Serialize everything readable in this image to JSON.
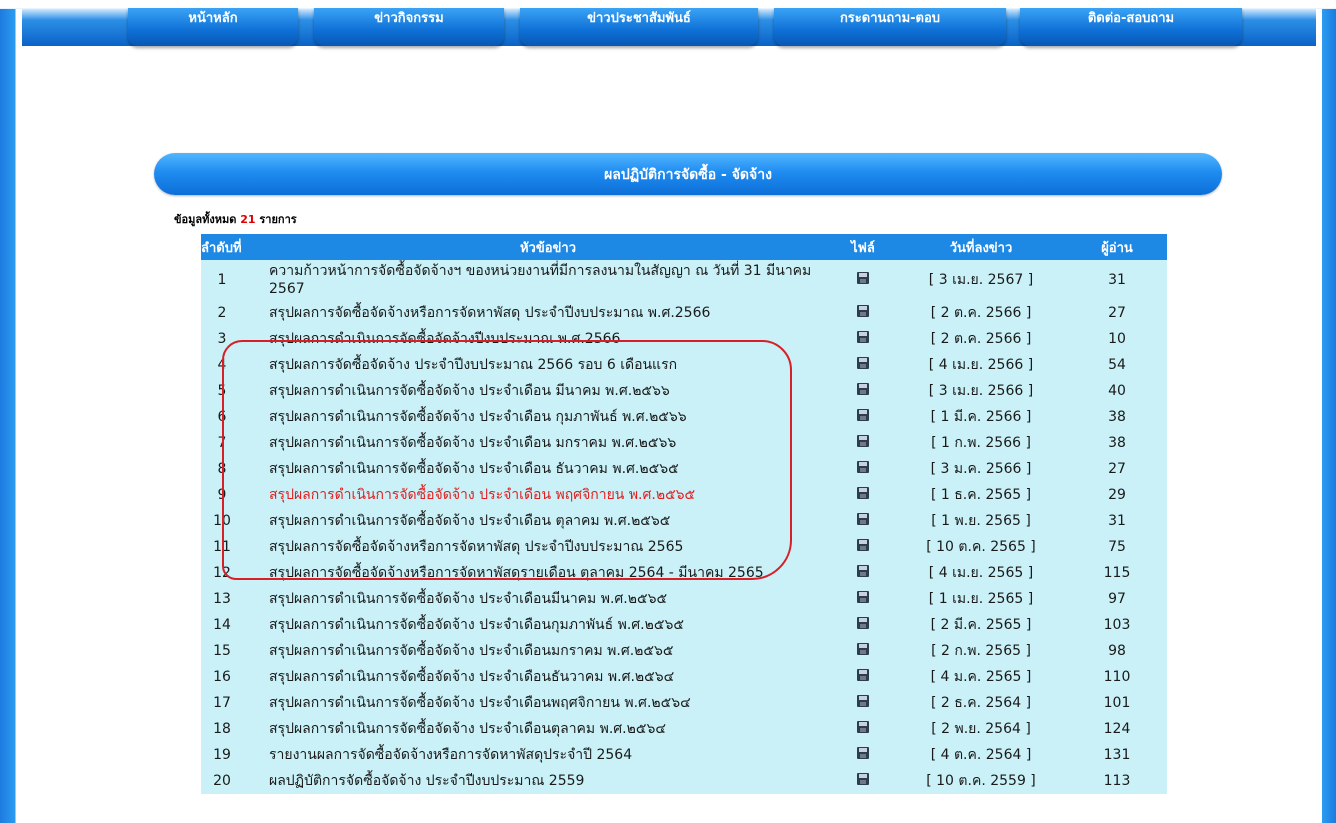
{
  "nav": {
    "items": [
      {
        "label": "หน้าหลัก"
      },
      {
        "label": "ข่าวกิจกรรม"
      },
      {
        "label": "ข่าวประชาสัมพันธ์"
      },
      {
        "label": "กระดานถาม-ตอบ"
      },
      {
        "label": "ติดต่อ-สอบถาม"
      }
    ]
  },
  "page": {
    "title": "ผลปฏิบัติการจัดซื้อ - จัดจ้าง",
    "count_prefix": "ข้อมูลทั้งหมด",
    "count": "21",
    "count_suffix": "รายการ"
  },
  "table": {
    "headers": {
      "index": "ลำดับที่",
      "title": "หัวข้อข่าว",
      "file": "ไฟล์",
      "date": "วันที่ลงข่าว",
      "readers": "ผู้อ่าน"
    },
    "rows": [
      {
        "no": "1",
        "title": "ความก้าวหน้าการจัดซื้อจัดจ้างฯ ของหน่วยงานที่มีการลงนามในสัญญา ณ วันที่ 31 มีนาคม 2567",
        "date": "[ 3 เม.ย. 2567 ]",
        "readers": "31"
      },
      {
        "no": "2",
        "title": "สรุปผลการจัดซื้อจัดจ้างหรือการจัดหาพัสดุ ประจำปีงบประมาณ พ.ศ.2566",
        "date": "[ 2 ต.ค. 2566 ]",
        "readers": "27"
      },
      {
        "no": "3",
        "title": "สรุปผลการดำเนินการจัดซื้อจัดจ้างปีงบประมาณ พ.ศ.2566",
        "date": "[ 2 ต.ค. 2566 ]",
        "readers": "10"
      },
      {
        "no": "4",
        "title": "สรุปผลการจัดซื้อจัดจ้าง ประจำปีงบประมาณ 2566 รอบ 6 เดือนแรก",
        "date": "[ 4 เม.ย. 2566 ]",
        "readers": "54"
      },
      {
        "no": "5",
        "title": "สรุปผลการดำเนินการจัดซื้อจัดจ้าง ประจำเดือน มีนาคม พ.ศ.๒๕๖๖",
        "date": "[ 3 เม.ย. 2566 ]",
        "readers": "40"
      },
      {
        "no": "6",
        "title": "สรุปผลการดำเนินการจัดซื้อจัดจ้าง ประจำเดือน กุมภาพันธ์ พ.ศ.๒๕๖๖",
        "date": "[ 1 มี.ค. 2566 ]",
        "readers": "38"
      },
      {
        "no": "7",
        "title": "สรุปผลการดำเนินการจัดซื้อจัดจ้าง ประจำเดือน มกราคม พ.ศ.๒๕๖๖",
        "date": "[ 1 ก.พ. 2566 ]",
        "readers": "38"
      },
      {
        "no": "8",
        "title": "สรุปผลการดำเนินการจัดซื้อจัดจ้าง ประจำเดือน ธันวาคม พ.ศ.๒๕๖๕",
        "date": "[ 3 ม.ค. 2566 ]",
        "readers": "27"
      },
      {
        "no": "9",
        "title": "สรุปผลการดำเนินการจัดซื้อจัดจ้าง ประจำเดือน พฤศจิกายน พ.ศ.๒๕๖๕",
        "date": "[ 1 ธ.ค. 2565 ]",
        "readers": "29",
        "highlight": true
      },
      {
        "no": "10",
        "title": "สรุปผลการดำเนินการจัดซื้อจัดจ้าง ประจำเดือน ตุลาคม พ.ศ.๒๕๖๕",
        "date": "[ 1 พ.ย. 2565 ]",
        "readers": "31"
      },
      {
        "no": "11",
        "title": "สรุปผลการจัดซื้อจัดจ้างหรือการจัดหาพัสดุ ประจำปีงบประมาณ 2565",
        "date": "[ 10 ต.ค. 2565 ]",
        "readers": "75"
      },
      {
        "no": "12",
        "title": "สรุปผลการจัดซื้อจัดจ้างหรือการจัดหาพัสดุรายเดือน ตุลาคม 2564 - มีนาคม 2565",
        "date": "[ 4 เม.ย. 2565 ]",
        "readers": "115"
      },
      {
        "no": "13",
        "title": "สรุปผลการดำเนินการจัดซื้อจัดจ้าง ประจำเดือนมีนาคม พ.ศ.๒๕๖๕",
        "date": "[ 1 เม.ย. 2565 ]",
        "readers": "97"
      },
      {
        "no": "14",
        "title": "สรุปผลการดำเนินการจัดซื้อจัดจ้าง ประจำเดือนกุมภาพันธ์ พ.ศ.๒๕๖๕",
        "date": "[ 2 มี.ค. 2565 ]",
        "readers": "103"
      },
      {
        "no": "15",
        "title": "สรุปผลการดำเนินการจัดซื้อจัดจ้าง ประจำเดือนมกราคม พ.ศ.๒๕๖๕",
        "date": "[ 2 ก.พ. 2565 ]",
        "readers": "98"
      },
      {
        "no": "16",
        "title": "สรุปผลการดำเนินการจัดซื้อจัดจ้าง ประจำเดือนธันวาคม พ.ศ.๒๕๖๔",
        "date": "[ 4 ม.ค. 2565 ]",
        "readers": "110"
      },
      {
        "no": "17",
        "title": "สรุปผลการดำเนินการจัดซื้อจัดจ้าง ประจำเดือนพฤศจิกายน พ.ศ.๒๕๖๔",
        "date": "[ 2 ธ.ค. 2564 ]",
        "readers": "101"
      },
      {
        "no": "18",
        "title": "สรุปผลการดำเนินการจัดซื้อจัดจ้าง ประจำเดือนตุลาคม พ.ศ.๒๕๖๔",
        "date": "[ 2 พ.ย. 2564 ]",
        "readers": "124"
      },
      {
        "no": "19",
        "title": "รายงานผลการจัดซื้อจัดจ้างหรือการจัดหาพัสดุประจำปี 2564",
        "date": "[ 4 ต.ค. 2564 ]",
        "readers": "131"
      },
      {
        "no": "20",
        "title": "ผลปฏิบัติการจัดซื้อจัดจ้าง ประจำปีงบประมาณ 2559",
        "date": "[ 10 ต.ค. 2559 ]",
        "readers": "113"
      }
    ]
  },
  "colors": {
    "nav_blue": "#0e6fd6",
    "header_blue": "#1e88e5",
    "row_cyan": "#c9f1f7",
    "highlight_red": "#e21f1f",
    "annotation_red": "#d81f26"
  },
  "icons": {
    "file": "floppy-disk-icon"
  }
}
